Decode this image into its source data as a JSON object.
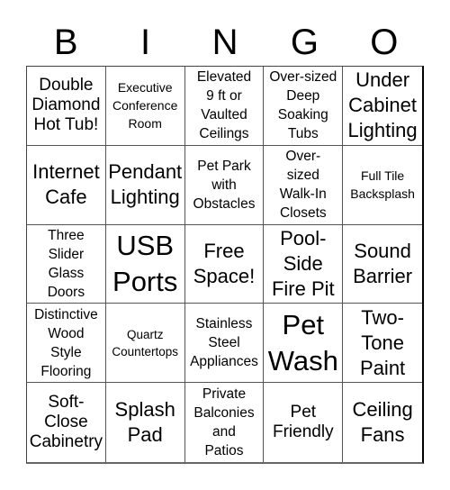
{
  "header": {
    "letters": [
      "B",
      "I",
      "N",
      "G",
      "O"
    ]
  },
  "board": {
    "cells": [
      {
        "text": "Double\nDiamond\nHot Tub!",
        "size": "lg"
      },
      {
        "text": "Executive\nConference\nRoom",
        "size": "sm"
      },
      {
        "text": "Elevated\n9 ft or\nVaulted\nCeilings",
        "size": "md"
      },
      {
        "text": "Over-sized\nDeep\nSoaking\nTubs",
        "size": "md"
      },
      {
        "text": "Under\nCabinet\nLighting",
        "size": "xl"
      },
      {
        "text": "Internet\nCafe",
        "size": "xl"
      },
      {
        "text": "Pendant\nLighting",
        "size": "xl"
      },
      {
        "text": "Pet Park\nwith\nObstacles",
        "size": "md"
      },
      {
        "text": "Over-\nsized\nWalk-In\nClosets",
        "size": "md"
      },
      {
        "text": "Full Tile\nBacksplash",
        "size": "sm"
      },
      {
        "text": "Three\nSlider\nGlass\nDoors",
        "size": "md"
      },
      {
        "text": "USB\nPorts",
        "size": "xxl"
      },
      {
        "text": "Free\nSpace!",
        "size": "xl"
      },
      {
        "text": "Pool-\nSide\nFire Pit",
        "size": "xl"
      },
      {
        "text": "Sound\nBarrier",
        "size": "xl"
      },
      {
        "text": "Distinctive\nWood\nStyle\nFlooring",
        "size": "md"
      },
      {
        "text": "Quartz\nCountertops",
        "size": "sm2"
      },
      {
        "text": "Stainless\nSteel\nAppliances",
        "size": "md"
      },
      {
        "text": "Pet\nWash",
        "size": "xxl"
      },
      {
        "text": "Two-\nTone\nPaint",
        "size": "xl"
      },
      {
        "text": "Soft-\nClose\nCabinetry",
        "size": "lg"
      },
      {
        "text": "Splash\nPad",
        "size": "xl"
      },
      {
        "text": "Private\nBalconies\nand\nPatios",
        "size": "md"
      },
      {
        "text": "Pet\nFriendly",
        "size": "lg"
      },
      {
        "text": "Ceiling\nFans",
        "size": "xl"
      }
    ]
  }
}
